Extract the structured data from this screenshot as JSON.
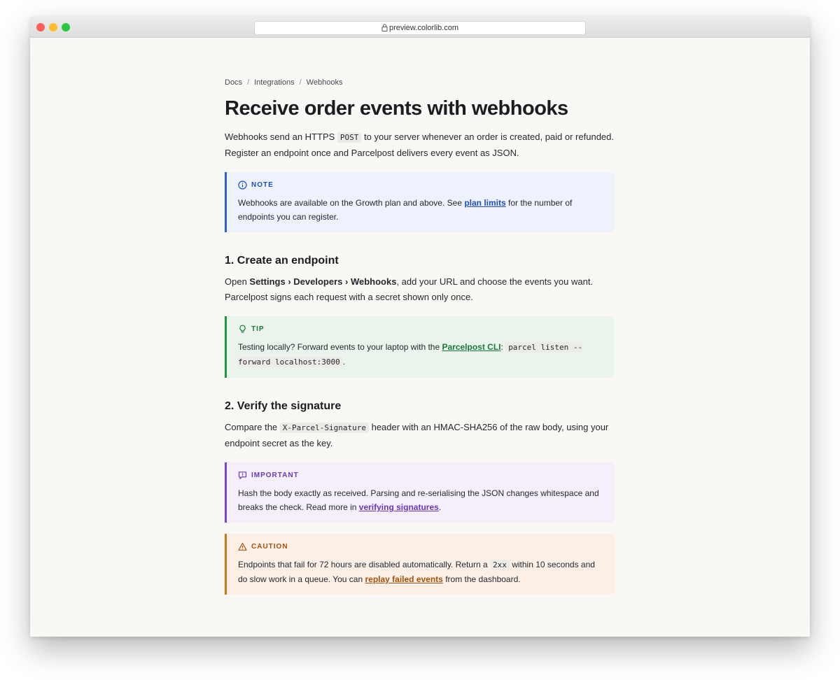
{
  "browser": {
    "url": "preview.colorlib.com"
  },
  "breadcrumb": [
    "Docs",
    "Integrations",
    "Webhooks"
  ],
  "page": {
    "title": "Receive order events with webhooks",
    "intro_1": "Webhooks send an HTTPS ",
    "intro_code": "POST",
    "intro_2": " to your server whenever an order is created, paid or refunded. Register an endpoint once and Parcelpost delivers every event as JSON."
  },
  "note": {
    "label": "NOTE",
    "icon": "info-icon",
    "text_1": "Webhooks are available on the Growth plan and above. See ",
    "link": "plan limits",
    "text_2": " for the number of endpoints you can register."
  },
  "section1": {
    "heading": "1. Create an endpoint",
    "text_1": "Open ",
    "bold_1": "Settings",
    "arrow": " › ",
    "bold_2": "Developers",
    "bold_3": "Webhooks",
    "text_2": ", add your URL and choose the events you want. Parcelpost signs each request with a secret shown only once."
  },
  "tip": {
    "label": "TIP",
    "icon": "lightbulb-icon",
    "text_1": "Testing locally? Forward events to your laptop with the ",
    "link": "Parcelpost CLI",
    "text_2": ": ",
    "code": "parcel listen --forward localhost:3000",
    "text_3": "."
  },
  "section2": {
    "heading": "2. Verify the signature",
    "text_1": "Compare the ",
    "code": "X-Parcel-Signature",
    "text_2": " header with an HMAC-SHA256 of the raw body, using your endpoint secret as the key."
  },
  "important": {
    "label": "IMPORTANT",
    "icon": "message-icon",
    "text_1": "Hash the body exactly as received. Parsing and re-serialising the JSON changes whitespace and breaks the check. Read more in ",
    "link": "verifying signatures",
    "text_2": "."
  },
  "caution": {
    "label": "CAUTION",
    "icon": "warning-icon",
    "text_1": "Endpoints that fail for 72 hours are disabled automatically. Return a ",
    "code": "2xx",
    "text_2": " within 10 seconds and do slow work in a queue. You can ",
    "link": "replay failed events",
    "text_3": " from the dashboard."
  },
  "colors": {
    "note": "#2f62d0",
    "tip": "#1f9a45",
    "important": "#7a46d0",
    "caution": "#d07a18"
  }
}
